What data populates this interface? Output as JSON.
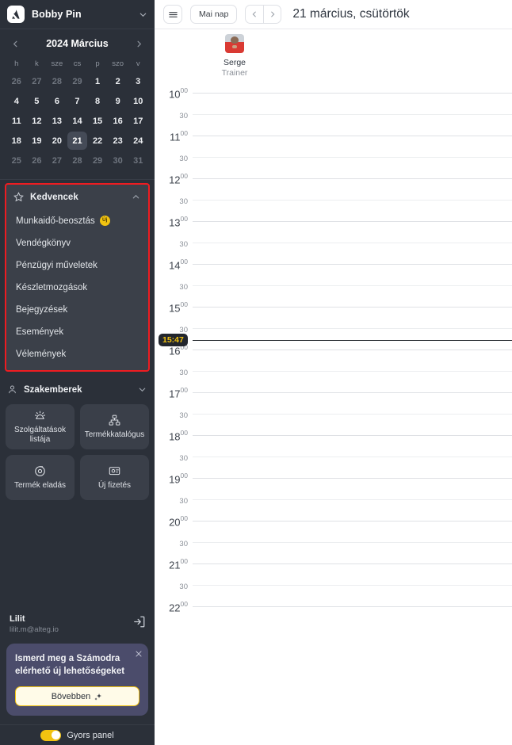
{
  "sidebar": {
    "brand": "Bobby Pin",
    "brand_chevron_icon": "chevron-down-icon",
    "logo_icon": "app-logo-icon",
    "calendar": {
      "title": "2024 Március",
      "prev_icon": "chevron-left-icon",
      "next_icon": "chevron-right-icon",
      "dow": [
        "h",
        "k",
        "sze",
        "cs",
        "p",
        "szo",
        "v"
      ],
      "weeks": [
        [
          {
            "d": "26",
            "muted": true
          },
          {
            "d": "27",
            "muted": true
          },
          {
            "d": "28",
            "muted": true
          },
          {
            "d": "29",
            "muted": true
          },
          {
            "d": "1"
          },
          {
            "d": "2"
          },
          {
            "d": "3"
          }
        ],
        [
          {
            "d": "4"
          },
          {
            "d": "5"
          },
          {
            "d": "6"
          },
          {
            "d": "7"
          },
          {
            "d": "8"
          },
          {
            "d": "9"
          },
          {
            "d": "10"
          }
        ],
        [
          {
            "d": "11"
          },
          {
            "d": "12"
          },
          {
            "d": "13"
          },
          {
            "d": "14"
          },
          {
            "d": "15"
          },
          {
            "d": "16"
          },
          {
            "d": "17"
          }
        ],
        [
          {
            "d": "18"
          },
          {
            "d": "19"
          },
          {
            "d": "20"
          },
          {
            "d": "21",
            "selected": true
          },
          {
            "d": "22"
          },
          {
            "d": "23"
          },
          {
            "d": "24"
          }
        ],
        [
          {
            "d": "25",
            "muted": true
          },
          {
            "d": "26",
            "muted": true
          },
          {
            "d": "27",
            "muted": true
          },
          {
            "d": "28",
            "muted": true
          },
          {
            "d": "29",
            "muted": true
          },
          {
            "d": "30",
            "muted": true
          },
          {
            "d": "31",
            "muted": true
          }
        ]
      ]
    },
    "favorites": {
      "title": "Kedvencek",
      "star_icon": "star-icon",
      "chevron_icon": "chevron-up-icon",
      "highlight_color": "#ee1c21",
      "items": [
        {
          "label": "Munkaidő-beosztás",
          "badge": "Új"
        },
        {
          "label": "Vendégkönyv"
        },
        {
          "label": "Pénzügyi műveletek"
        },
        {
          "label": "Készletmozgások"
        },
        {
          "label": "Bejegyzések"
        },
        {
          "label": "Események"
        },
        {
          "label": "Vélemények"
        }
      ]
    },
    "staff_group": {
      "title": "Szakemberek",
      "person_icon": "person-icon",
      "chevron_icon": "chevron-down-icon"
    },
    "tiles": [
      {
        "label": "Szolgáltatások listája",
        "icon": "services-list-icon"
      },
      {
        "label": "Termékkatalógus",
        "icon": "product-catalog-icon"
      },
      {
        "label": "Termék eladás",
        "icon": "product-sale-icon"
      },
      {
        "label": "Új fizetés",
        "icon": "new-payment-icon"
      }
    ],
    "user": {
      "name": "Lilit",
      "email": "lilit.m@alteg.io",
      "logout_icon": "logout-icon"
    },
    "promo": {
      "text": "Ismerd meg a Számodra elérhető új lehetőségeket",
      "button_label": "Bövebben",
      "button_icon": "sparkles-icon",
      "close_icon": "close-icon",
      "card_color": "#4b4c6b",
      "accent_color": "#f2c310"
    },
    "quick_panel": {
      "label": "Gyors panel",
      "toggle_on": true,
      "toggle_color": "#f2c310"
    }
  },
  "main": {
    "topbar": {
      "menu_icon": "hamburger-menu-icon",
      "today_label": "Mai nap",
      "prev_icon": "chevron-left-icon",
      "next_icon": "chevron-right-icon",
      "date_title": "21 március, csütörtök"
    },
    "staff_column": {
      "name": "Serge",
      "role": "Trainer",
      "avatar_icon": "avatar"
    },
    "calendar": {
      "hours": [
        "10",
        "11",
        "12",
        "13",
        "14",
        "15",
        "16",
        "17",
        "18",
        "19",
        "20",
        "21",
        "22"
      ],
      "hour_suffix": "00",
      "half_label": "30",
      "now_time": "15:47",
      "now_color": "#f2c310"
    }
  }
}
